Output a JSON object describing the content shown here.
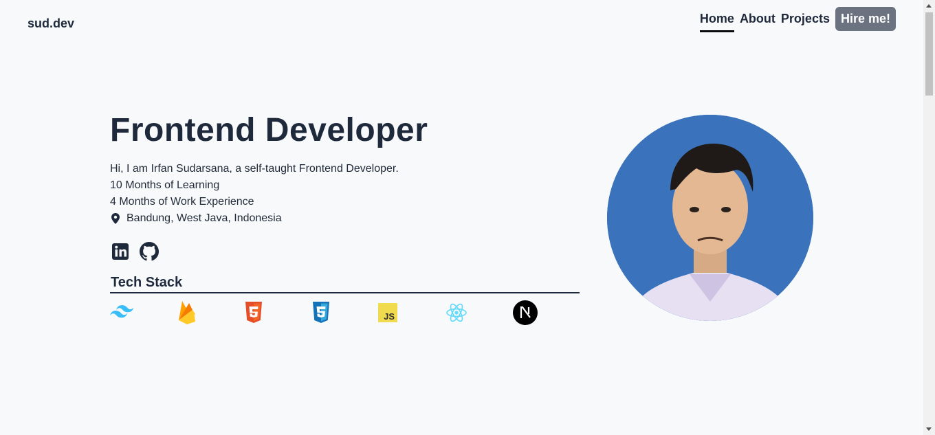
{
  "nav": {
    "logo": "sud.dev",
    "links": [
      {
        "label": "Home",
        "active": true
      },
      {
        "label": "About",
        "active": false
      },
      {
        "label": "Projects",
        "active": false
      }
    ],
    "cta_label": "Hire me!"
  },
  "hero": {
    "title": "Frontend Developer",
    "lines": [
      "Hi, I am Irfan Sudarsana, a self-taught Frontend Developer.",
      "10 Months of Learning",
      "4 Months of Work Experience"
    ],
    "location": "Bandung, West Java, Indonesia",
    "location_icon": "map-pin-icon",
    "social": [
      "linkedin-icon",
      "github-icon"
    ]
  },
  "tech_stack": {
    "title": "Tech Stack",
    "items": [
      "tailwind-icon",
      "firebase-icon",
      "html5-icon",
      "css3-icon",
      "javascript-icon",
      "react-icon",
      "nextjs-icon"
    ]
  },
  "colors": {
    "text": "#1e293b",
    "hire_button": "#6b7280",
    "avatar_bg": "#3a73bc",
    "page_bg": "#f8f9fb"
  }
}
